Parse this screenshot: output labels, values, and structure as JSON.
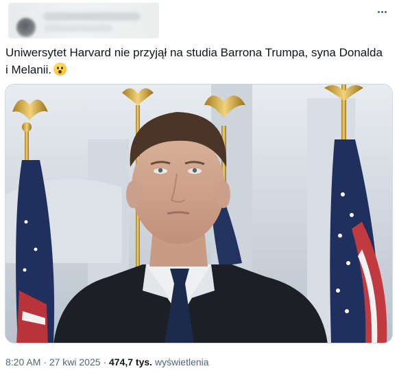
{
  "tweet": {
    "text_line1": "Uniwersytet Harvard nie przyjął na studia Barrona Trumpa, syna Donalda",
    "text_line2": "i Melanii.",
    "emoji": "😮",
    "time": "8:20 AM",
    "separator": "·",
    "date": "27 kwi 2025",
    "views_count": "474,7 tys.",
    "views_label": "wyświetlenia"
  },
  "icons": {
    "more": "more-horizontal-icon"
  },
  "colors": {
    "text": "#0f1419",
    "secondary": "#536471",
    "border": "#cfd9de"
  }
}
